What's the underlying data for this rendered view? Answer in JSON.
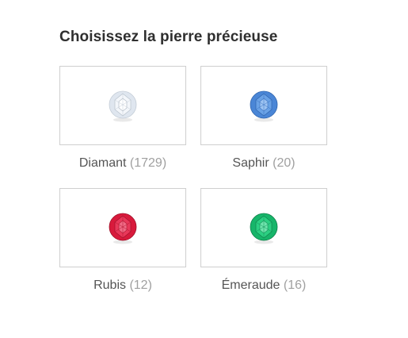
{
  "heading": "Choisissez la pierre précieuse",
  "stones": [
    {
      "name": "Diamant",
      "count": "(1729)",
      "icon": "diamond-icon",
      "color": "#dfe6ef"
    },
    {
      "name": "Saphir",
      "count": "(20)",
      "icon": "sapphire-icon",
      "color": "#4a86d6"
    },
    {
      "name": "Rubis",
      "count": "(12)",
      "icon": "ruby-icon",
      "color": "#d81a3c"
    },
    {
      "name": "Émeraude",
      "count": "(16)",
      "icon": "emerald-icon",
      "color": "#17b56a"
    }
  ]
}
